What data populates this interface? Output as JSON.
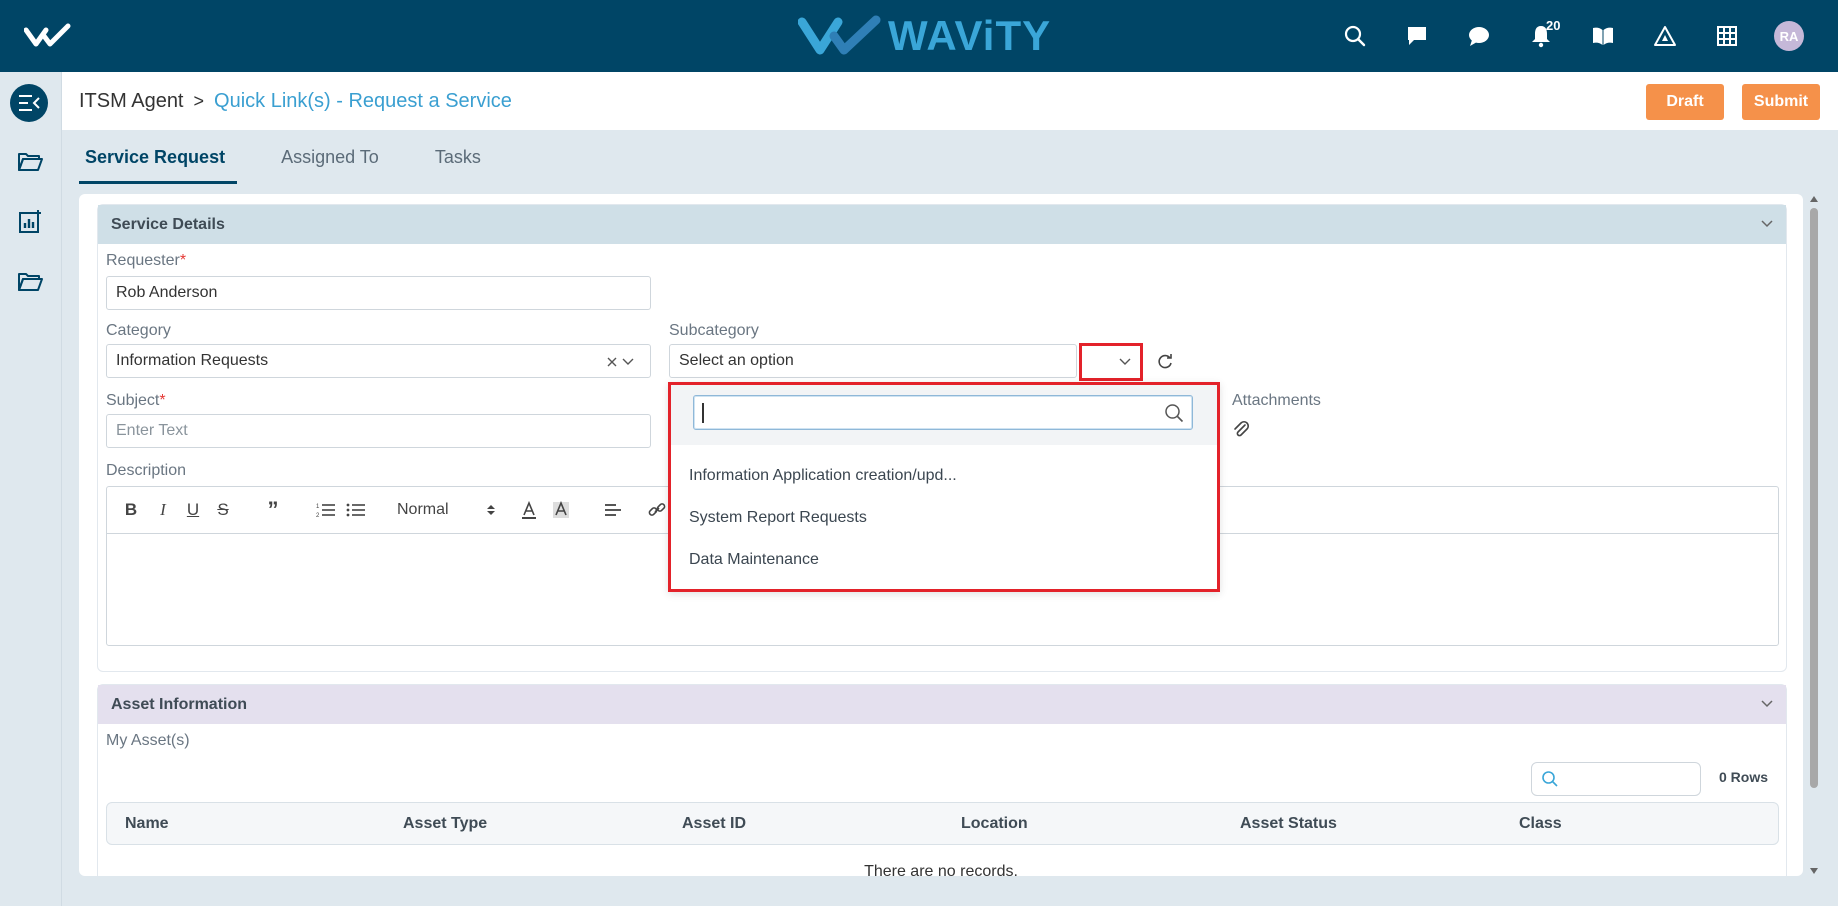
{
  "app": {
    "brand_name": "WAViTY",
    "notification_count": "20",
    "user_initials": "RA"
  },
  "breadcrumb": {
    "root": "ITSM Agent",
    "separator": ">",
    "current": "Quick Link(s) - Request a Service"
  },
  "actions": {
    "draft_label": "Draft",
    "submit_label": "Submit"
  },
  "tabs": [
    {
      "label": "Service Request",
      "active": true
    },
    {
      "label": "Assigned To",
      "active": false
    },
    {
      "label": "Tasks",
      "active": false
    }
  ],
  "service_details": {
    "title": "Service Details",
    "requester_label": "Requester",
    "requester_value": "Rob Anderson",
    "category_label": "Category",
    "category_value": "Information Requests",
    "subcategory_label": "Subcategory",
    "subcategory_placeholder": "Select an option",
    "subject_label": "Subject",
    "subject_placeholder": "Enter Text",
    "attachments_label": "Attachments",
    "description_label": "Description",
    "format_value": "Normal",
    "required_mark": "*"
  },
  "subcategory_dropdown": {
    "options": [
      "Information Application creation/upd...",
      "System Report Requests",
      "Data Maintenance"
    ]
  },
  "asset_information": {
    "title": "Asset Information",
    "my_assets_label": "My Asset(s)",
    "rows_count": "0 Rows",
    "columns": [
      "Name",
      "Asset Type",
      "Asset ID",
      "Location",
      "Asset Status",
      "Class"
    ],
    "empty_text": "There are no records."
  },
  "colors": {
    "topbar": "#004566",
    "brand": "#3aa6d8",
    "accent_orange": "#f5914a",
    "highlight_red": "#e3222a"
  }
}
